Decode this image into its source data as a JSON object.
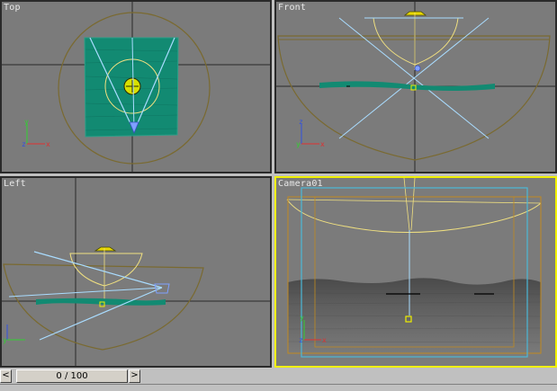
{
  "viewports": {
    "top": {
      "label": "Top"
    },
    "front": {
      "label": "Front"
    },
    "left": {
      "label": "Left"
    },
    "camera": {
      "label": "Camera01"
    }
  },
  "time_slider": {
    "frame_label": "0 / 100",
    "prev_glyph": "<",
    "next_glyph": ">"
  },
  "axis_labels": {
    "x": "x",
    "y": "y",
    "z": "z"
  },
  "colors": {
    "viewport_bg": "#7b7b7b",
    "active_border": "#f0f000",
    "camera_line": "#a9dcff",
    "dome": "#8a7a3a",
    "light": "#f0e080",
    "water": "#1a8a78"
  }
}
